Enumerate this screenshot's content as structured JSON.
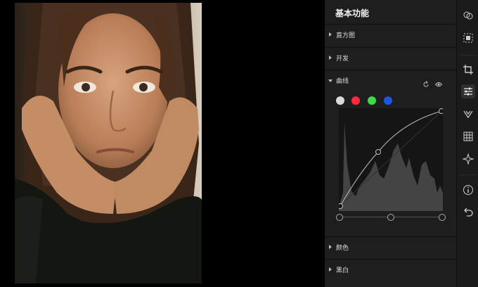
{
  "panel": {
    "title": "基本功能",
    "sections": [
      {
        "label": "直方图"
      },
      {
        "label": "开发"
      },
      {
        "label": "曲线"
      },
      {
        "label": "颜色"
      },
      {
        "label": "黑白"
      }
    ]
  },
  "curves": {
    "channels": [
      {
        "name": "rgb",
        "color": "#d9d9d9"
      },
      {
        "name": "red",
        "color": "#ff2a3c"
      },
      {
        "name": "green",
        "color": "#3cdc46"
      },
      {
        "name": "blue",
        "color": "#1e56e6"
      }
    ],
    "head_icons": [
      "reset-icon",
      "eye-icon"
    ]
  },
  "toolbar": {
    "icons": [
      "overlay-circles-icon",
      "auto-enhance-icon",
      "crop-icon",
      "adjust-sliders-icon",
      "heal-icon",
      "filter-icon",
      "magic-sparkle-icon",
      "info-icon",
      "undo-icon"
    ]
  },
  "colors": {
    "panel_bg": "#1e1e1e",
    "canvas_bg": "#000000"
  }
}
